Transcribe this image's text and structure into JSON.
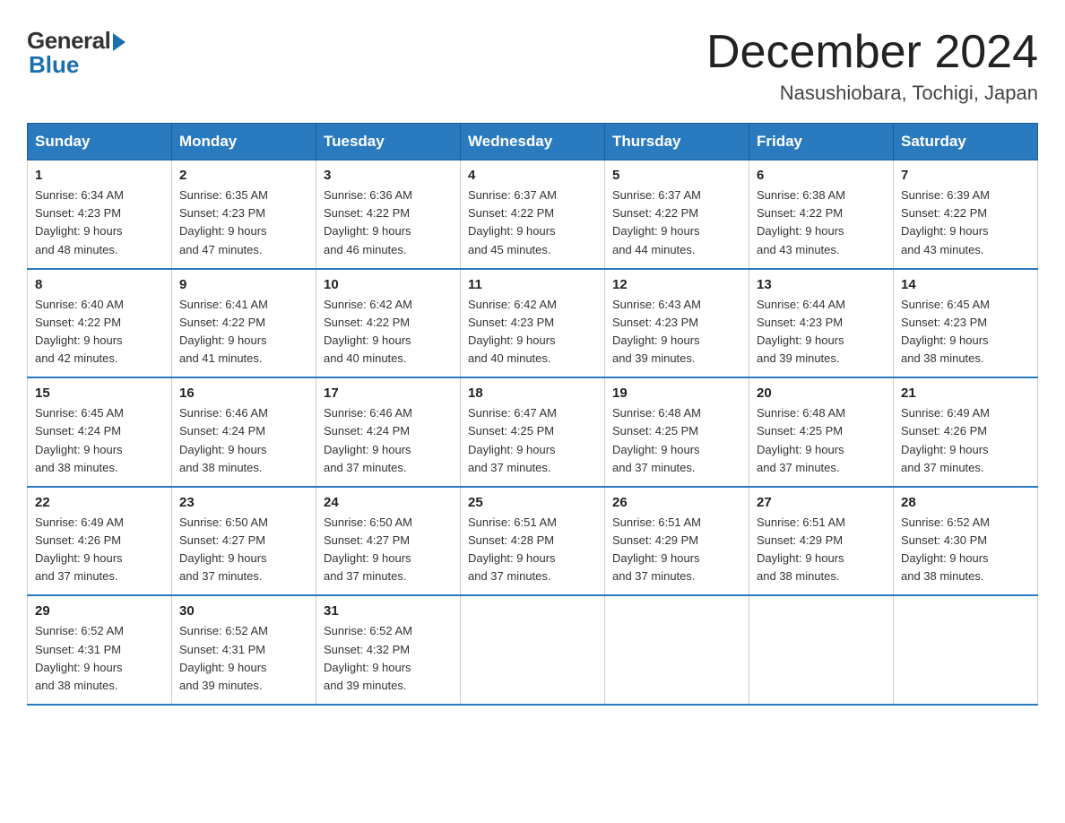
{
  "logo": {
    "general": "General",
    "blue": "Blue"
  },
  "title": "December 2024",
  "location": "Nasushiobara, Tochigi, Japan",
  "days_of_week": [
    "Sunday",
    "Monday",
    "Tuesday",
    "Wednesday",
    "Thursday",
    "Friday",
    "Saturday"
  ],
  "weeks": [
    [
      {
        "day": "1",
        "sunrise": "6:34 AM",
        "sunset": "4:23 PM",
        "daylight": "9 hours and 48 minutes."
      },
      {
        "day": "2",
        "sunrise": "6:35 AM",
        "sunset": "4:23 PM",
        "daylight": "9 hours and 47 minutes."
      },
      {
        "day": "3",
        "sunrise": "6:36 AM",
        "sunset": "4:22 PM",
        "daylight": "9 hours and 46 minutes."
      },
      {
        "day": "4",
        "sunrise": "6:37 AM",
        "sunset": "4:22 PM",
        "daylight": "9 hours and 45 minutes."
      },
      {
        "day": "5",
        "sunrise": "6:37 AM",
        "sunset": "4:22 PM",
        "daylight": "9 hours and 44 minutes."
      },
      {
        "day": "6",
        "sunrise": "6:38 AM",
        "sunset": "4:22 PM",
        "daylight": "9 hours and 43 minutes."
      },
      {
        "day": "7",
        "sunrise": "6:39 AM",
        "sunset": "4:22 PM",
        "daylight": "9 hours and 43 minutes."
      }
    ],
    [
      {
        "day": "8",
        "sunrise": "6:40 AM",
        "sunset": "4:22 PM",
        "daylight": "9 hours and 42 minutes."
      },
      {
        "day": "9",
        "sunrise": "6:41 AM",
        "sunset": "4:22 PM",
        "daylight": "9 hours and 41 minutes."
      },
      {
        "day": "10",
        "sunrise": "6:42 AM",
        "sunset": "4:22 PM",
        "daylight": "9 hours and 40 minutes."
      },
      {
        "day": "11",
        "sunrise": "6:42 AM",
        "sunset": "4:23 PM",
        "daylight": "9 hours and 40 minutes."
      },
      {
        "day": "12",
        "sunrise": "6:43 AM",
        "sunset": "4:23 PM",
        "daylight": "9 hours and 39 minutes."
      },
      {
        "day": "13",
        "sunrise": "6:44 AM",
        "sunset": "4:23 PM",
        "daylight": "9 hours and 39 minutes."
      },
      {
        "day": "14",
        "sunrise": "6:45 AM",
        "sunset": "4:23 PM",
        "daylight": "9 hours and 38 minutes."
      }
    ],
    [
      {
        "day": "15",
        "sunrise": "6:45 AM",
        "sunset": "4:24 PM",
        "daylight": "9 hours and 38 minutes."
      },
      {
        "day": "16",
        "sunrise": "6:46 AM",
        "sunset": "4:24 PM",
        "daylight": "9 hours and 38 minutes."
      },
      {
        "day": "17",
        "sunrise": "6:46 AM",
        "sunset": "4:24 PM",
        "daylight": "9 hours and 37 minutes."
      },
      {
        "day": "18",
        "sunrise": "6:47 AM",
        "sunset": "4:25 PM",
        "daylight": "9 hours and 37 minutes."
      },
      {
        "day": "19",
        "sunrise": "6:48 AM",
        "sunset": "4:25 PM",
        "daylight": "9 hours and 37 minutes."
      },
      {
        "day": "20",
        "sunrise": "6:48 AM",
        "sunset": "4:25 PM",
        "daylight": "9 hours and 37 minutes."
      },
      {
        "day": "21",
        "sunrise": "6:49 AM",
        "sunset": "4:26 PM",
        "daylight": "9 hours and 37 minutes."
      }
    ],
    [
      {
        "day": "22",
        "sunrise": "6:49 AM",
        "sunset": "4:26 PM",
        "daylight": "9 hours and 37 minutes."
      },
      {
        "day": "23",
        "sunrise": "6:50 AM",
        "sunset": "4:27 PM",
        "daylight": "9 hours and 37 minutes."
      },
      {
        "day": "24",
        "sunrise": "6:50 AM",
        "sunset": "4:27 PM",
        "daylight": "9 hours and 37 minutes."
      },
      {
        "day": "25",
        "sunrise": "6:51 AM",
        "sunset": "4:28 PM",
        "daylight": "9 hours and 37 minutes."
      },
      {
        "day": "26",
        "sunrise": "6:51 AM",
        "sunset": "4:29 PM",
        "daylight": "9 hours and 37 minutes."
      },
      {
        "day": "27",
        "sunrise": "6:51 AM",
        "sunset": "4:29 PM",
        "daylight": "9 hours and 38 minutes."
      },
      {
        "day": "28",
        "sunrise": "6:52 AM",
        "sunset": "4:30 PM",
        "daylight": "9 hours and 38 minutes."
      }
    ],
    [
      {
        "day": "29",
        "sunrise": "6:52 AM",
        "sunset": "4:31 PM",
        "daylight": "9 hours and 38 minutes."
      },
      {
        "day": "30",
        "sunrise": "6:52 AM",
        "sunset": "4:31 PM",
        "daylight": "9 hours and 39 minutes."
      },
      {
        "day": "31",
        "sunrise": "6:52 AM",
        "sunset": "4:32 PM",
        "daylight": "9 hours and 39 minutes."
      },
      null,
      null,
      null,
      null
    ]
  ],
  "labels": {
    "sunrise": "Sunrise:",
    "sunset": "Sunset:",
    "daylight": "Daylight:"
  }
}
